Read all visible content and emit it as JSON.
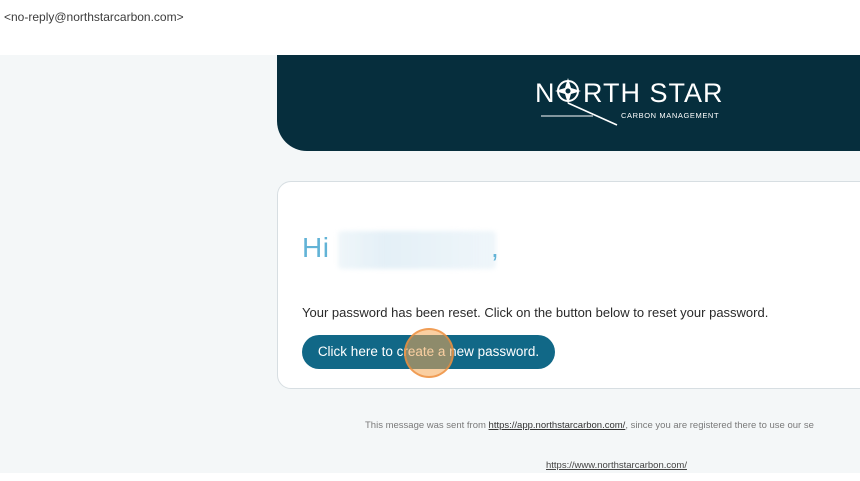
{
  "email": {
    "sender": "<no-reply@northstarcarbon.com>"
  },
  "logo": {
    "name_left": "N",
    "name_right": "RTH STAR",
    "tagline": "CARBON MANAGEMENT"
  },
  "card": {
    "greeting": "Hi",
    "comma": ",",
    "message": "Your password has been reset. Click on the button below to reset your password.",
    "button_label": "Click here to create a new password."
  },
  "footer": {
    "prefix": "This message was sent from ",
    "app_link": "https://app.northstarcarbon.com/",
    "suffix": ", since you are registered there to use our se",
    "site_link": "https://www.northstarcarbon.com/"
  },
  "colors": {
    "header_bg": "#062e3d",
    "button_bg": "#116887",
    "greeting": "#62b3d6",
    "body_bg": "#f4f7f8"
  }
}
